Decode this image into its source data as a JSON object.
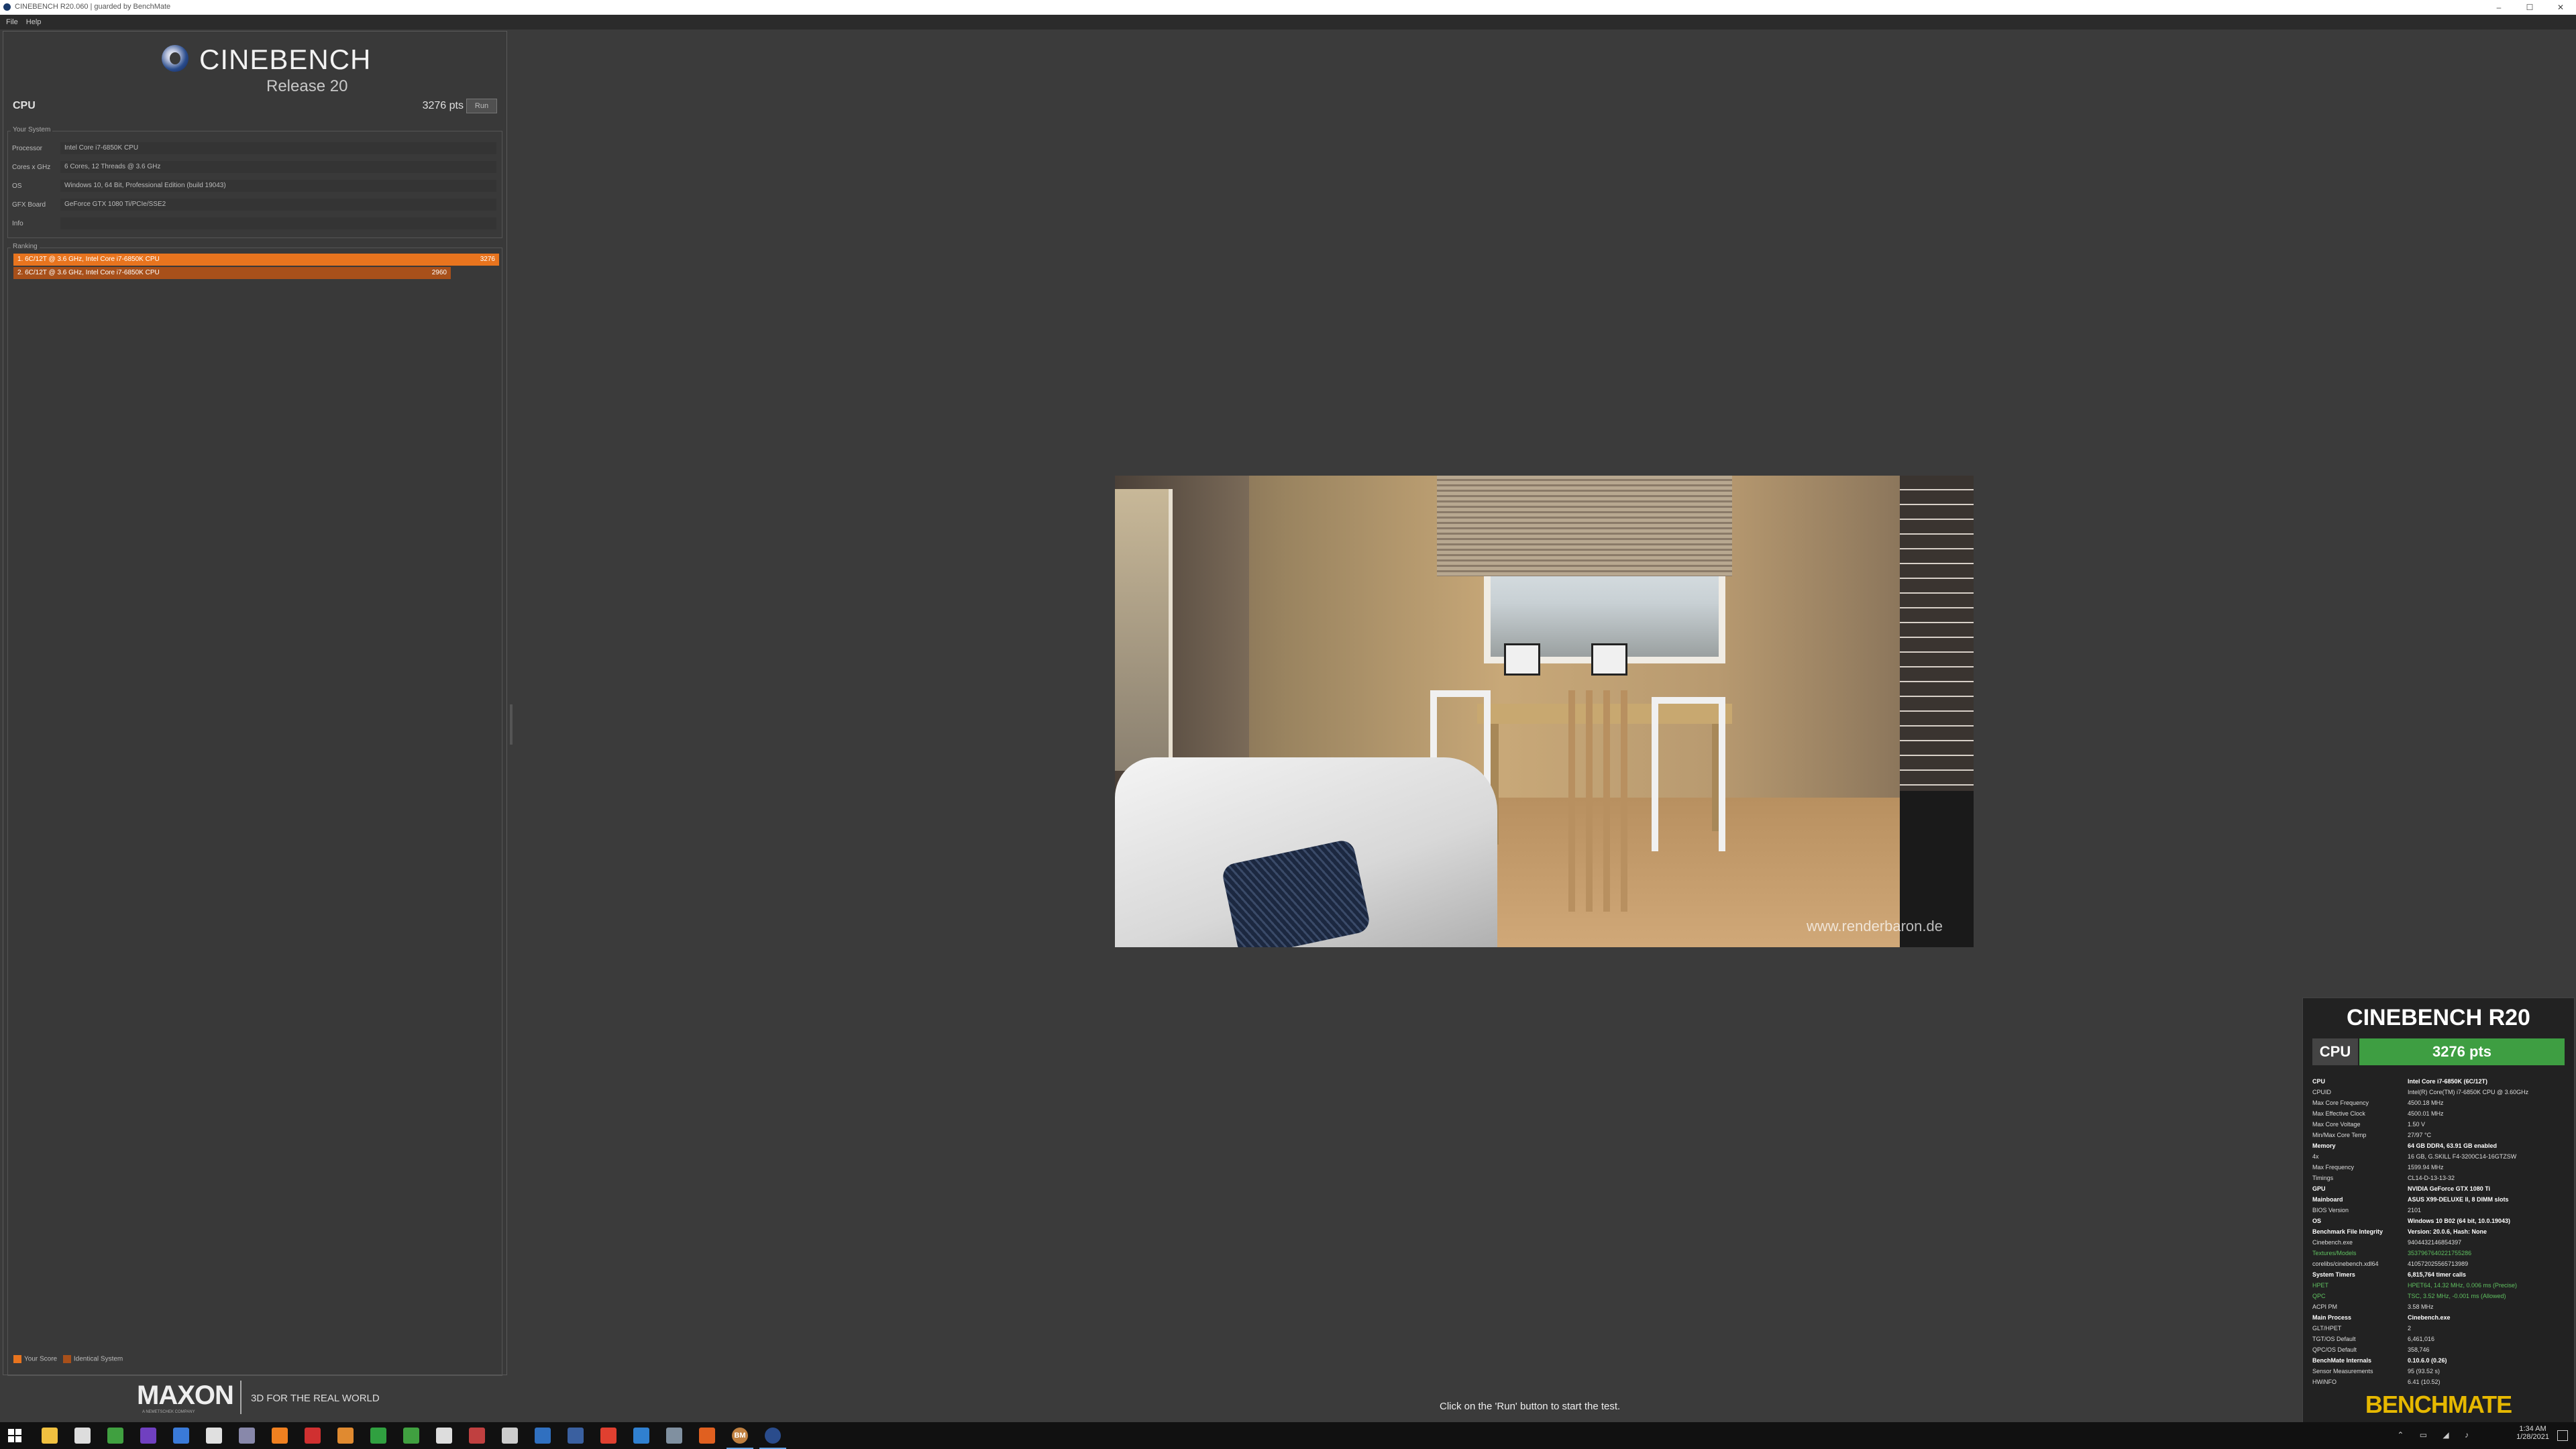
{
  "window": {
    "title": "CINEBENCH R20.060 | guarded by BenchMate",
    "buttons": [
      "–",
      "☐",
      "✕"
    ]
  },
  "menu": [
    "File",
    "Help"
  ],
  "logo": {
    "title": "CINEBENCH",
    "subtitle": "Release 20"
  },
  "cpu_test": {
    "label": "CPU",
    "score": "3276 pts",
    "run_label": "Run"
  },
  "your_system": {
    "title": "Your System",
    "rows": [
      {
        "key": "Processor",
        "value": "Intel Core i7-6850K CPU"
      },
      {
        "key": "Cores x GHz",
        "value": "6 Cores, 12 Threads @ 3.6 GHz"
      },
      {
        "key": "OS",
        "value": "Windows 10, 64 Bit, Professional Edition (build 19043)"
      },
      {
        "key": "GFX Board",
        "value": "GeForce GTX 1080 Ti/PCIe/SSE2"
      },
      {
        "key": "Info",
        "value": ""
      }
    ]
  },
  "ranking": {
    "title": "Ranking",
    "entries": [
      {
        "label": "1. 6C/12T @ 3.6 GHz, Intel Core i7-6850K CPU",
        "score": "3276",
        "fraction": 1.0,
        "color": "#e8741e"
      },
      {
        "label": "2. 6C/12T @ 3.6 GHz, Intel Core i7-6850K CPU",
        "score": "2960",
        "fraction": 0.9,
        "color": "#a8501a"
      }
    ],
    "legend": [
      {
        "label": "Your Score",
        "color": "#e8741e"
      },
      {
        "label": "Identical System",
        "color": "#a8501a"
      }
    ]
  },
  "render": {
    "watermark": "www.renderbaron.de"
  },
  "status_text": "Click on the 'Run' button to start the test.",
  "maxon": {
    "logo": "MAXON",
    "sub": "A NEMETSCHEK COMPANY",
    "tagline": "3D FOR THE REAL WORLD"
  },
  "benchmate": {
    "title": "CINEBENCH R20",
    "cpu_label": "CPU",
    "score": "3276 pts",
    "rows": [
      {
        "k": "CPU",
        "v": "Intel Core i7-6850K (6C/12T)",
        "style": "bold"
      },
      {
        "k": "CPUID",
        "v": "Intel(R) Core(TM) i7-6850K CPU @ 3.60GHz",
        "style": ""
      },
      {
        "k": "Max Core Frequency",
        "v": "4500.18 MHz",
        "style": ""
      },
      {
        "k": "Max Effective Clock",
        "v": "4500.01 MHz",
        "style": ""
      },
      {
        "k": "Max Core Voltage",
        "v": "1.50 V",
        "style": ""
      },
      {
        "k": "Min/Max Core Temp",
        "v": "27/97 °C",
        "style": ""
      },
      {
        "k": "Memory",
        "v": "64 GB DDR4, 63.91 GB enabled",
        "style": "bold"
      },
      {
        "k": "4x",
        "v": "16 GB, G.SKILL F4-3200C14-16GTZSW",
        "style": ""
      },
      {
        "k": "Max Frequency",
        "v": "1599.94 MHz",
        "style": ""
      },
      {
        "k": "Timings",
        "v": "CL14-D-13-13-32",
        "style": ""
      },
      {
        "k": "GPU",
        "v": "NVIDIA GeForce GTX 1080 Ti",
        "style": "bold"
      },
      {
        "k": "Mainboard",
        "v": "ASUS X99-DELUXE II, 8 DIMM slots",
        "style": "bold"
      },
      {
        "k": "BIOS Version",
        "v": "2101",
        "style": ""
      },
      {
        "k": "OS",
        "v": "Windows 10 B02 (64 bit, 10.0.19043)",
        "style": "bold"
      },
      {
        "k": "Benchmark File Integrity",
        "v": "Version: 20.0.6, Hash: None",
        "style": "bold"
      },
      {
        "k": "Cinebench.exe",
        "v": "9404432146854397",
        "style": ""
      },
      {
        "k": "Textures/Models",
        "v": "3537967640221755286",
        "style": "green"
      },
      {
        "k": "corelibs/cinebench.xdl64",
        "v": "410572025565713989",
        "style": ""
      },
      {
        "k": "System Timers",
        "v": "6,815,764 timer calls",
        "style": "bold"
      },
      {
        "k": "HPET",
        "v": "HPET64, 14.32 MHz, 0.006 ms (Precise)",
        "style": "green"
      },
      {
        "k": "QPC",
        "v": "TSC, 3.52 MHz, -0.001 ms (Allowed)",
        "style": "green"
      },
      {
        "k": "ACPI PM",
        "v": "3.58 MHz",
        "style": ""
      },
      {
        "k": "Main Process",
        "v": "Cinebench.exe",
        "style": "bold"
      },
      {
        "k": "GLT/HPET",
        "v": "2",
        "style": ""
      },
      {
        "k": "TGT/OS Default",
        "v": "6,461,016",
        "style": ""
      },
      {
        "k": "QPC/OS Default",
        "v": "358,746",
        "style": ""
      },
      {
        "k": "BenchMate Internals",
        "v": "0.10.6.0 (0.26)",
        "style": "bold"
      },
      {
        "k": "Sensor Measurements",
        "v": "95 (93.52 s)",
        "style": ""
      },
      {
        "k": "HWiNFO",
        "v": "6.41 (10.52)",
        "style": ""
      }
    ],
    "footer": "BENCHMATE"
  },
  "taskbar": {
    "time": "1:34 AM",
    "date": "1/28/2021",
    "tray_icons": "⌃ ▭ ◢ ♪",
    "apps": [
      {
        "name": "file-explorer-icon",
        "color": "#f0c040"
      },
      {
        "name": "calendar-icon",
        "color": "#dddddd"
      },
      {
        "name": "terminal-icon",
        "color": "#40a040"
      },
      {
        "name": "app-purple-icon",
        "color": "#7040c0"
      },
      {
        "name": "store-icon",
        "color": "#3a7ad8"
      },
      {
        "name": "notepad-icon",
        "color": "#e0e0e0"
      },
      {
        "name": "printer-icon",
        "color": "#8888aa"
      },
      {
        "name": "vlc-icon",
        "color": "#f08020"
      },
      {
        "name": "app-red-icon",
        "color": "#d03030"
      },
      {
        "name": "folder-orange-icon",
        "color": "#e08a30"
      },
      {
        "name": "monitor-icon",
        "color": "#30a040"
      },
      {
        "name": "xbox-icon",
        "color": "#40a040"
      },
      {
        "name": "display-icon",
        "color": "#dddddd"
      },
      {
        "name": "app-red2-icon",
        "color": "#c04040"
      },
      {
        "name": "steam-icon",
        "color": "#cccccc"
      },
      {
        "name": "app-blue-icon",
        "color": "#3070c0"
      },
      {
        "name": "cinebench-icon",
        "color": "#3a60a0"
      },
      {
        "name": "chrome-icon",
        "color": "#e04030"
      },
      {
        "name": "window-icon",
        "color": "#3080d0"
      },
      {
        "name": "app-gray-icon",
        "color": "#8090a0"
      },
      {
        "name": "firefox-icon",
        "color": "#e06020"
      },
      {
        "name": "benchmate-icon",
        "color": "#c08040"
      },
      {
        "name": "cinebench-running-icon",
        "color": "#2a4c8c"
      }
    ],
    "benchmate_label": "BM"
  }
}
